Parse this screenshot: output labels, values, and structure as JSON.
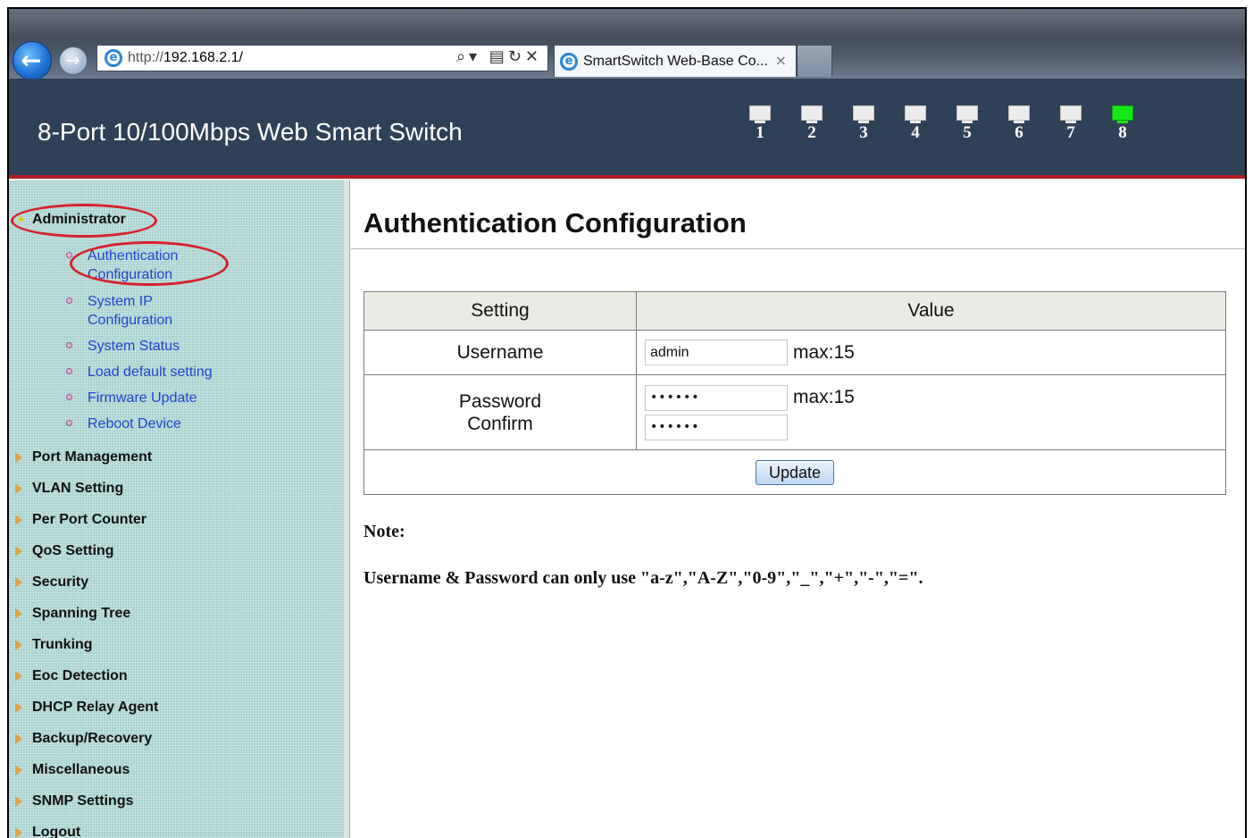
{
  "browser": {
    "address_prefix": "http://",
    "address_host": "192.168.2.1/",
    "tab_title": "SmartSwitch Web-Base Co...",
    "tab_close": "×"
  },
  "header": {
    "title": "8-Port 10/100Mbps Web Smart Switch",
    "ports": [
      {
        "num": "1",
        "active": false
      },
      {
        "num": "2",
        "active": false
      },
      {
        "num": "3",
        "active": false
      },
      {
        "num": "4",
        "active": false
      },
      {
        "num": "5",
        "active": false
      },
      {
        "num": "6",
        "active": false
      },
      {
        "num": "7",
        "active": false
      },
      {
        "num": "8",
        "active": true
      }
    ],
    "active_port_color": "#19e619",
    "accent_line_color": "#b31d22"
  },
  "sidebar": {
    "administrator": "Administrator",
    "sub_items": [
      "Authentication Configuration",
      "System IP Configuration",
      "System Status",
      "Load default setting",
      "Firmware Update",
      "Reboot Device"
    ],
    "menu": [
      "Port Management",
      "VLAN Setting",
      "Per Port Counter",
      "QoS Setting",
      "Security",
      "Spanning Tree",
      "Trunking",
      "Eoc Detection",
      "DHCP Relay Agent",
      "Backup/Recovery",
      "Miscellaneous",
      "SNMP Settings",
      "Logout"
    ]
  },
  "main": {
    "title": "Authentication Configuration",
    "table": {
      "col_setting": "Setting",
      "col_value": "Value",
      "username_label": "Username",
      "username_value": "admin",
      "username_max": "max:15",
      "password_label": "Password",
      "confirm_label": "Confirm",
      "password_value": "••••••",
      "confirm_value": "••••••",
      "password_max": "max:15",
      "update_button": "Update"
    },
    "note_title": "Note:",
    "note_text": "Username & Password can only use \"a-z\",\"A-Z\",\"0-9\",\"_\",\"+\",\"-\",\"=\"."
  }
}
